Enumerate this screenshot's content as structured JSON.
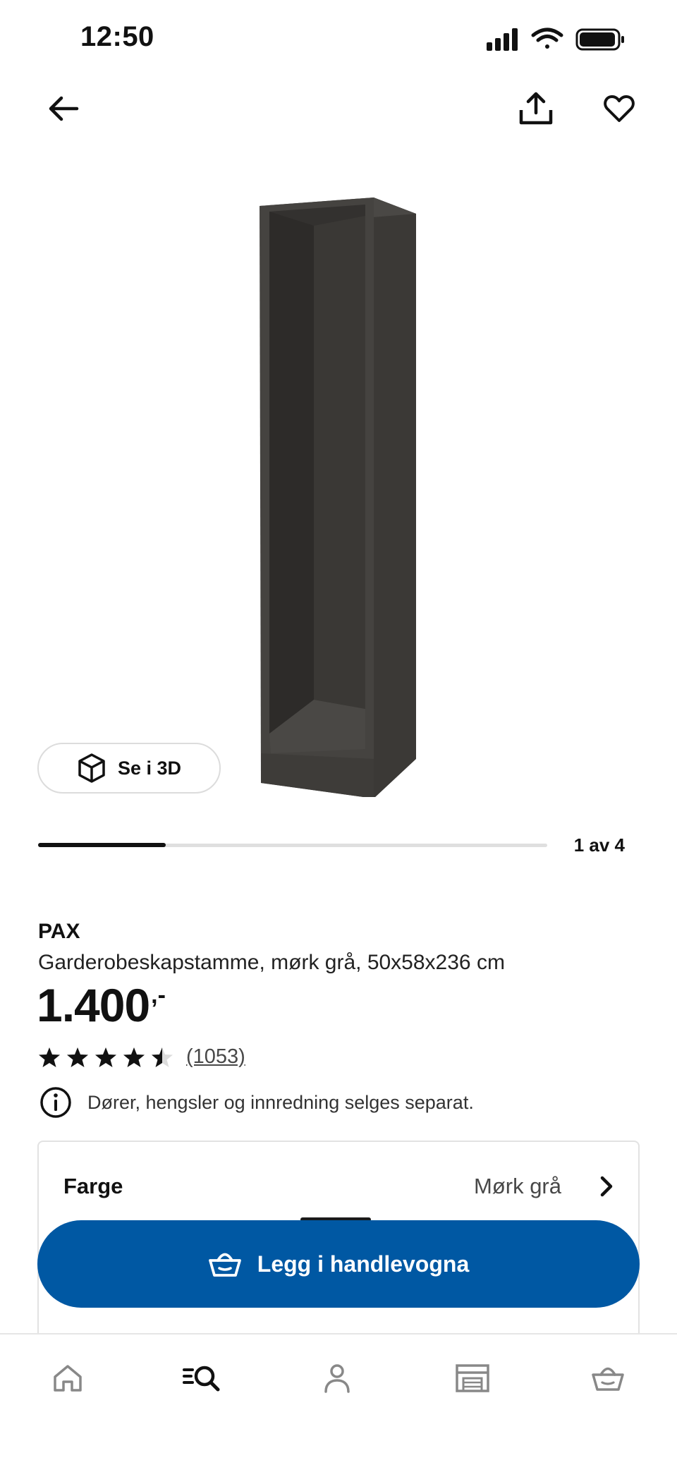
{
  "status_bar": {
    "time": "12:50"
  },
  "header": {
    "back_icon": "arrow-left-icon",
    "share_icon": "share-icon",
    "favorite_icon": "heart-outline-icon"
  },
  "gallery": {
    "view_3d_label": "Se i 3D",
    "view_3d_icon": "cube-icon",
    "counter": "1 av 4",
    "current_index": 1,
    "total": 4
  },
  "product": {
    "brand": "PAX",
    "description": "Garderobeskapstamme, mørk grå, 50x58x236 cm",
    "price": "1.400",
    "price_suffix": ",-",
    "rating": 4.5,
    "rating_max": 5,
    "review_count": "(1053)",
    "info_icon": "info-icon",
    "info_text": "Dører, hengsler og innredning selges separat."
  },
  "options": {
    "color_label": "Farge",
    "color_value": "Mørk grå"
  },
  "cart": {
    "label": "Legg i handlevogna",
    "icon": "basket-icon",
    "color": "#0058a3"
  },
  "bottom_nav": {
    "items": [
      {
        "icon": "home-icon"
      },
      {
        "icon": "search-icon",
        "active": true
      },
      {
        "icon": "profile-icon"
      },
      {
        "icon": "store-icon"
      },
      {
        "icon": "basket-icon"
      }
    ]
  }
}
